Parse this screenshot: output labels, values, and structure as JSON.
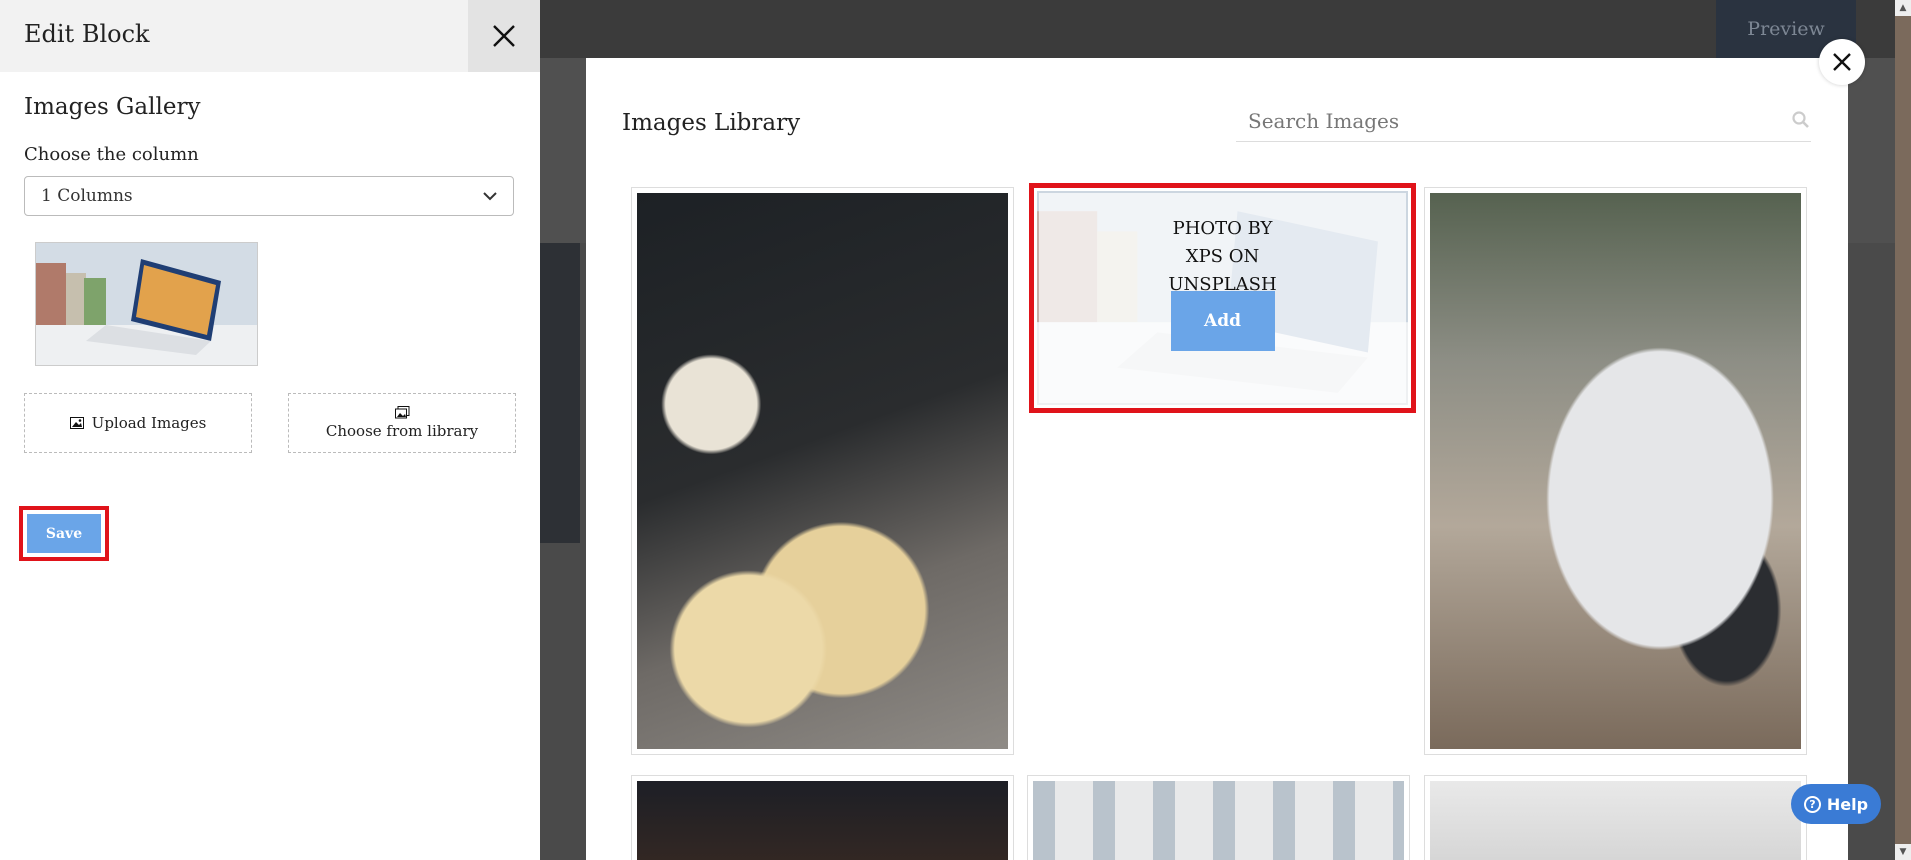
{
  "background": {
    "preview_label": "Preview"
  },
  "sidebar": {
    "title": "Edit Block",
    "section_title": "Images Gallery",
    "column_label": "Choose the column",
    "column_select_value": "1 Columns",
    "upload_label": "Upload Images",
    "library_label": "Choose from library",
    "save_label": "Save"
  },
  "modal": {
    "title": "Images Library",
    "search_placeholder": "Search Images",
    "hovered_caption": "PHOTO BY XPS ON UNSPLASH",
    "add_label": "Add"
  },
  "help": {
    "label": "Help"
  },
  "colors": {
    "accent": "#6aa5e8",
    "highlight": "#e0131a",
    "help": "#3a7bd5"
  }
}
